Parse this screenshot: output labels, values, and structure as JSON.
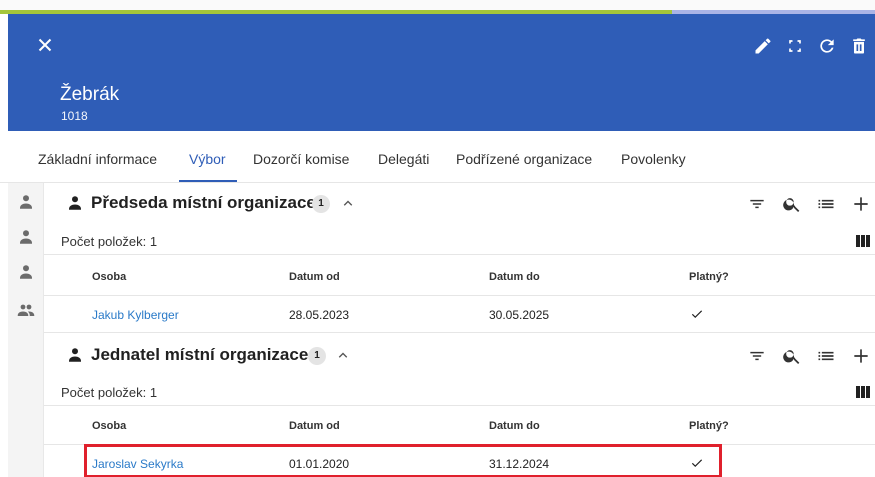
{
  "header": {
    "title": "Žebrák",
    "subtitle": "1018",
    "background_color": "#2f5db7",
    "actions": [
      "edit-icon",
      "fullscreen-icon",
      "refresh-icon",
      "delete-icon"
    ]
  },
  "tabs": [
    {
      "label": "Základní informace",
      "active": false
    },
    {
      "label": "Výbor",
      "active": true
    },
    {
      "label": "Dozorčí komise",
      "active": false
    },
    {
      "label": "Delegáti",
      "active": false
    },
    {
      "label": "Podřízené organizace",
      "active": false
    },
    {
      "label": "Povolenky",
      "active": false
    }
  ],
  "rail": {
    "icons": [
      "person-icon",
      "person-icon",
      "person-icon",
      "people-icon"
    ]
  },
  "columns": {
    "osoba": "Osoba",
    "datum_od": "Datum od",
    "datum_do": "Datum do",
    "platny": "Platný?"
  },
  "sections": [
    {
      "title": "Předseda místní organizace",
      "count_badge": "1",
      "count_text": "Počet položek: 1",
      "rows": [
        {
          "osoba": "Jakub Kylberger",
          "datum_od": "28.05.2023",
          "datum_do": "30.05.2025",
          "platny": true
        }
      ]
    },
    {
      "title": "Jednatel místní organizace",
      "count_badge": "1",
      "count_text": "Počet položek: 1",
      "rows": [
        {
          "osoba": "Jaroslav Sekyrka",
          "datum_od": "01.01.2020",
          "datum_do": "31.12.2024",
          "platny": true
        }
      ]
    }
  ],
  "colors": {
    "accent": "#2f5db7",
    "link": "#2a7ac8",
    "highlight": "#e0202c",
    "progress": "#a5c63b"
  }
}
